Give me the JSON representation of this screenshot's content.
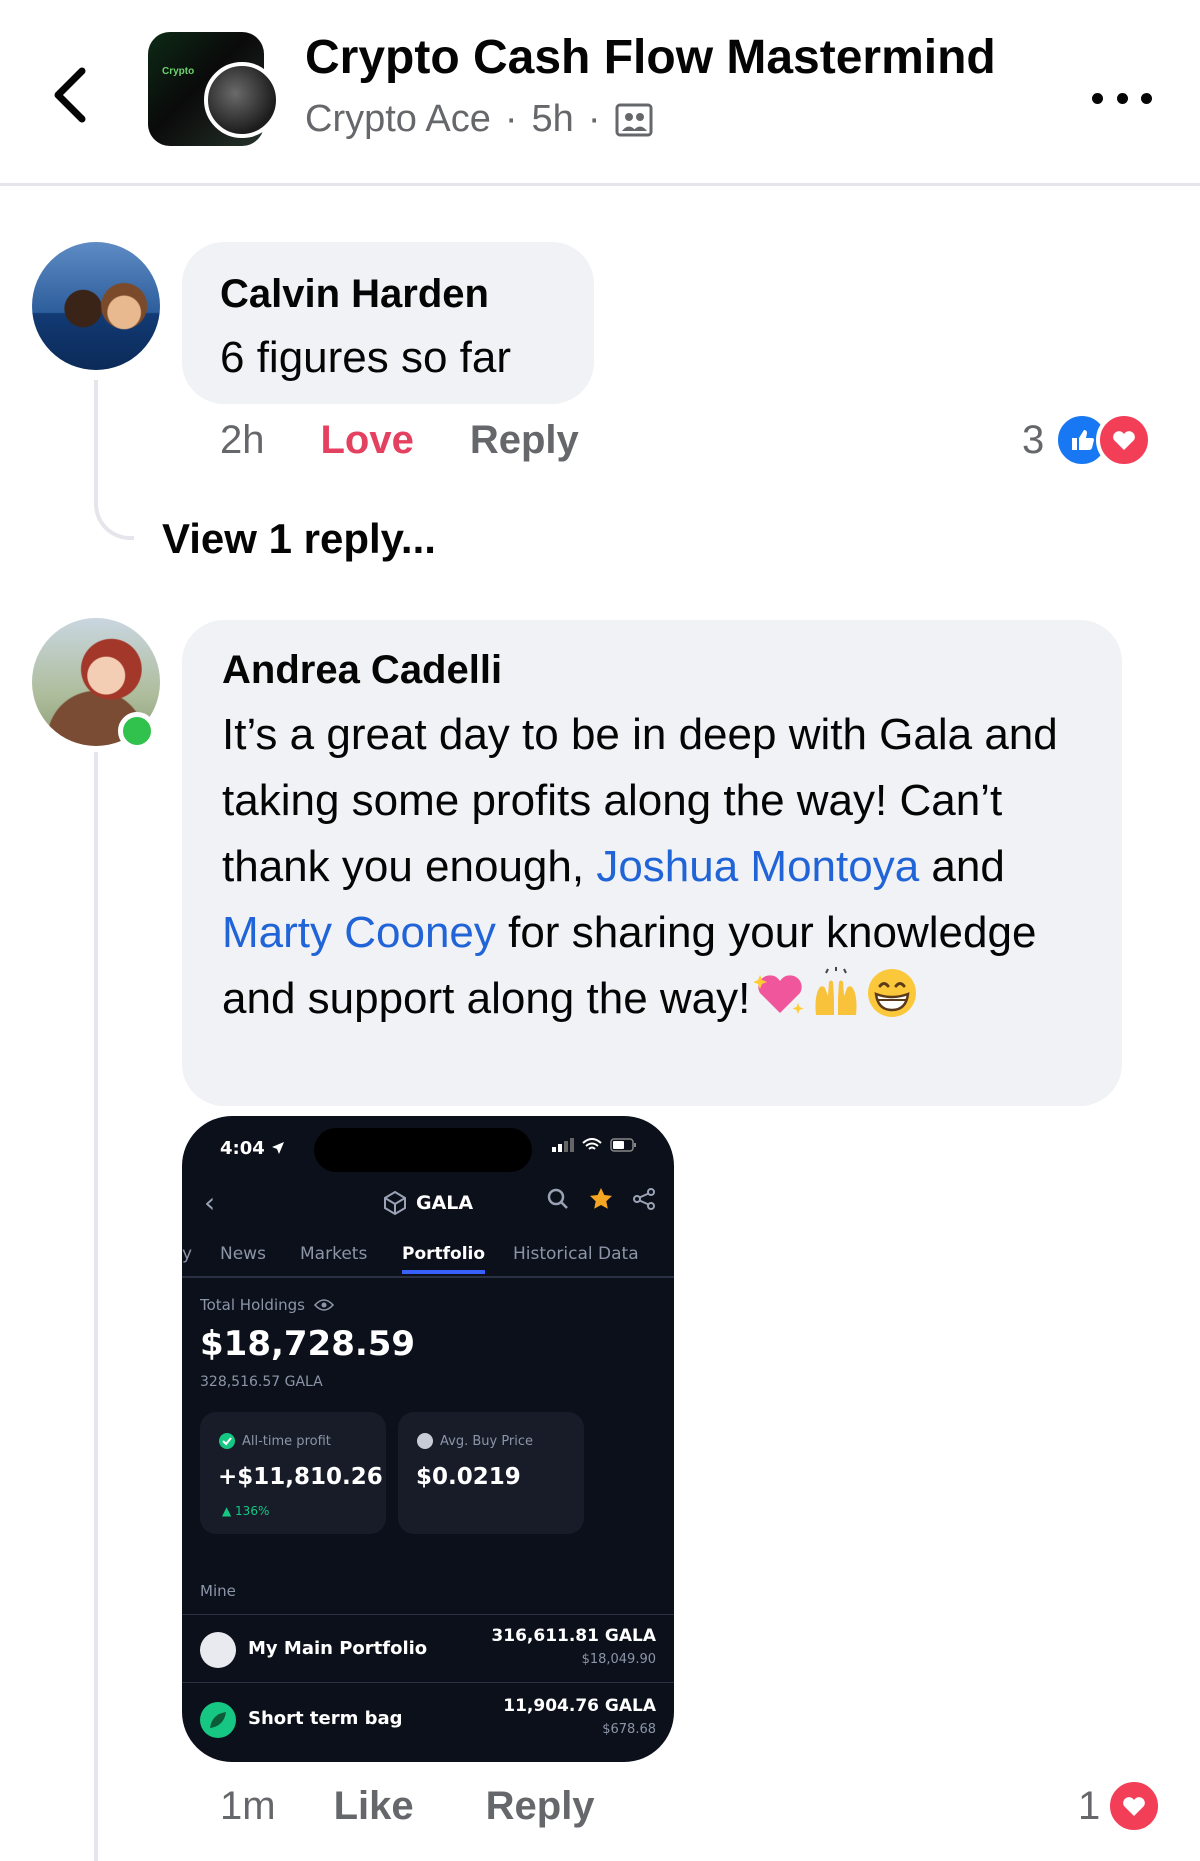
{
  "header": {
    "group_title": "Crypto Cash Flow Mastermind",
    "author": "Crypto Ace",
    "time": "5h",
    "sep": "·",
    "group_logo_text": "Crypto"
  },
  "comments": [
    {
      "name": "Calvin Harden",
      "text": "6 figures so far",
      "time": "2h",
      "reaction_action": "Love",
      "reply_label": "Reply",
      "reaction_count": "3",
      "view_replies": "View 1 reply..."
    },
    {
      "name": "Andrea Cadelli",
      "text_parts": [
        "It’s a great day to be in deep with Gala and taking some profits along the way! Can’t thank you enough, ",
        " and ",
        " for sharing your knowledge and support along the way!"
      ],
      "mentions": [
        "Joshua Montoya",
        "Marty Cooney"
      ],
      "emojis": [
        "sparkling-heart",
        "raising-hands",
        "grinning-face"
      ],
      "time": "1m",
      "like_label": "Like",
      "reply_label": "Reply",
      "reaction_count": "1",
      "online": true
    }
  ],
  "attachment": {
    "status_time": "4:04",
    "coin": "GALA",
    "tabs": [
      "y",
      "News",
      "Markets",
      "Portfolio",
      "Historical Data"
    ],
    "active_tab": "Portfolio",
    "total_label": "Total Holdings",
    "total_value": "$18,728.59",
    "total_coin": "328,516.57 GALA",
    "profit_label": "All-time profit",
    "profit_value": "+$11,810.26",
    "profit_change": "▲ 136%",
    "avg_label": "Avg. Buy Price",
    "avg_value": "$0.0219",
    "section_label": "Mine",
    "portfolios": [
      {
        "name": "My Main Portfolio",
        "amount": "316,611.81 GALA",
        "usd": "$18,049.90"
      },
      {
        "name": "Short term bag",
        "amount": "11,904.76 GALA",
        "usd": "$678.68"
      }
    ]
  },
  "colors": {
    "love": "#e4405f",
    "mention": "#2064d8",
    "like_blue": "#1877f2",
    "online": "#31c24d"
  }
}
